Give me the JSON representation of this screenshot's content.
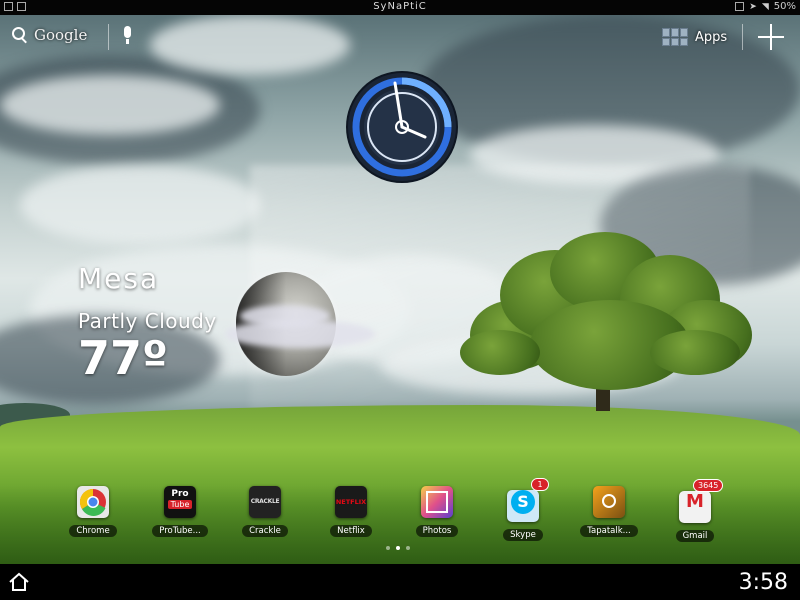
{
  "status_bar": {
    "carrier_title": "SyNaPtiC",
    "battery": "50%"
  },
  "search": {
    "label": "Google"
  },
  "apps_button": {
    "label": "Apps"
  },
  "weather": {
    "city": "Mesa",
    "condition": "Partly Cloudy",
    "temperature": "77º"
  },
  "dock": [
    {
      "label": "Chrome",
      "icon": "chrome-icon",
      "badge": ""
    },
    {
      "label": "ProTube...",
      "icon": "protube-icon",
      "badge": ""
    },
    {
      "label": "Crackle",
      "icon": "crackle-icon",
      "badge": ""
    },
    {
      "label": "Netflix",
      "icon": "netflix-icon",
      "badge": ""
    },
    {
      "label": "Photos",
      "icon": "photos-icon",
      "badge": ""
    },
    {
      "label": "Skype",
      "icon": "skype-icon",
      "badge": "1"
    },
    {
      "label": "Tapatalk...",
      "icon": "tapatalk-icon",
      "badge": ""
    },
    {
      "label": "Gmail",
      "icon": "gmail-icon",
      "badge": "3645"
    }
  ],
  "icon_text": {
    "protube_top": "Pro",
    "protube_bottom": "Tube",
    "crackle": "CRACKLE",
    "netflix": "NETFLIX",
    "skype": "S",
    "gmail": "M"
  },
  "nav_bar": {
    "time": "3:58"
  },
  "pager": {
    "pages": 3,
    "current": 2
  },
  "colors": {
    "badge": "#d8232a",
    "clock_ring": "#2f6fe0"
  }
}
